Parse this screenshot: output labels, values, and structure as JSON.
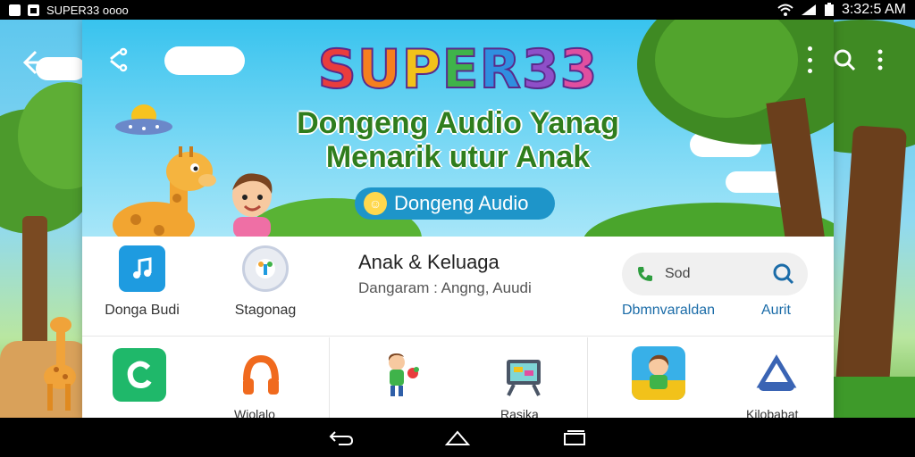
{
  "status_bar": {
    "app_name": "SUPER33 oooo",
    "time": "3:32:5 AM",
    "icons": [
      "notification-icon",
      "app-icon",
      "wifi-icon",
      "signal-icon",
      "battery-icon"
    ]
  },
  "app_bar": {
    "back_icon": "back-arrow-icon",
    "search_icon": "search-icon",
    "overflow_icon": "more-vert-icon"
  },
  "banner": {
    "logo_letters": [
      "S",
      "U",
      "P",
      "E",
      "R",
      "3",
      "3"
    ],
    "logo_colors": [
      "#e93d3d",
      "#f57f1f",
      "#f2c21a",
      "#3fb34a",
      "#2f8fe0",
      "#8e4fc8",
      "#e04fa0"
    ],
    "tagline_line1": "Dongeng Audio Yanag",
    "tagline_line2": "Menarik utur Anak",
    "pill_label": "Dongeng Audio",
    "share_icon": "share-icon",
    "more_icon": "more-vert-icon"
  },
  "info": {
    "tiles": [
      {
        "label": "Donga Budi",
        "icon": "music-note-icon",
        "color": "#1e9be0"
      },
      {
        "label": "Stagonag",
        "icon": "bulb-icon",
        "color": "#e9ecf2"
      }
    ],
    "title": "Anak & Keluaga",
    "subtitle": "Dangaram : Angng, Auudi",
    "search": {
      "value": "Sod"
    },
    "link_left": "Dbmnvaraldan",
    "link_right": "Aurit"
  },
  "grid": {
    "cells": [
      {
        "icon": "c-logo-icon",
        "label": ""
      },
      {
        "icon": "headphones-icon",
        "label": "Wiolalo"
      },
      {
        "icon": "boy-toy-icon",
        "label": ""
      },
      {
        "icon": "tv-icon",
        "label": "Rasika"
      },
      {
        "icon": "kid-card-icon",
        "label": ""
      },
      {
        "icon": "triangle-shape-icon",
        "label": "Kilobabat"
      }
    ]
  },
  "nav_bar": {
    "back": "nav-back-icon",
    "home": "nav-home-icon",
    "recents": "nav-recents-icon"
  },
  "colors": {
    "brand_blue": "#1e95c9",
    "tagline_green": "#2f7d1d",
    "link_blue": "#1b6ca8"
  }
}
